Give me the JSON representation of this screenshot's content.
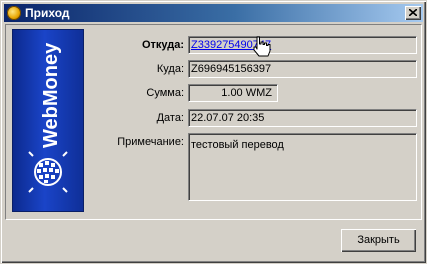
{
  "window": {
    "title": "Приход"
  },
  "banner": {
    "brand_text": "WebMoney"
  },
  "form": {
    "from_label": "Откуда:",
    "from_value": "Z339275490747",
    "to_label": "Куда:",
    "to_value": "Z696945156397",
    "amount_label": "Сумма:",
    "amount_value": "1.00 WMZ",
    "date_label": "Дата:",
    "date_value": "22.07.07 20:35",
    "note_label": "Примечание:",
    "note_value": "тестовый перевод"
  },
  "buttons": {
    "close_label": "Закрыть"
  },
  "icons": {
    "title": "webmoney-coin-icon",
    "close": "close-icon",
    "cursor": "hand-cursor-icon",
    "logo": "webmoney-globe-icon"
  }
}
